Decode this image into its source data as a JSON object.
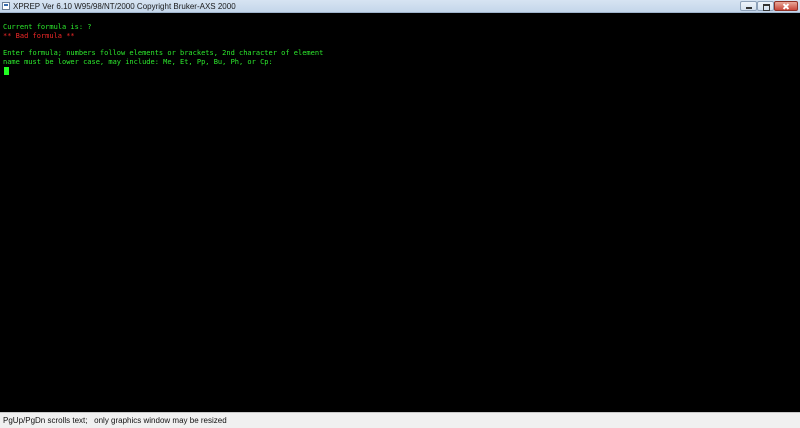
{
  "window": {
    "title": "XPREP Ver 6.10 W95/98/NT/2000 Copyright Bruker-AXS 2000",
    "icon": "console-window-icon",
    "controls": [
      "minimize",
      "maximize",
      "close"
    ]
  },
  "console": {
    "lines": [
      "Current formula is: ?",
      "** Bad formula **",
      "Enter formula; numbers follow elements or brackets, 2nd character of element",
      "name must be lower case, may include: Me, Et, Pp, Bu, Ph, or Cp:"
    ],
    "text_color": "#2dea2d",
    "error_color": "#f02828",
    "background": "#000000"
  },
  "statusbar": {
    "text": "PgUp/PgDn scrolls text;   only graphics window may be resized"
  }
}
